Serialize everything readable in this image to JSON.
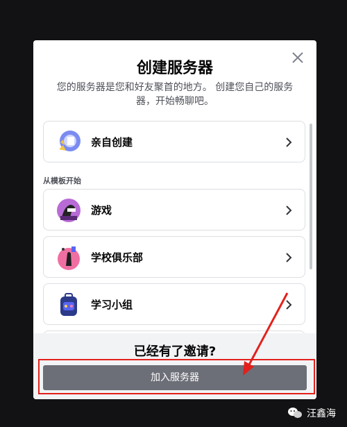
{
  "modal": {
    "title": "创建服务器",
    "subtitle": "您的服务器是您和好友聚首的地方。 创建您自己的服务器，开始畅聊吧。",
    "close_icon": "close-icon"
  },
  "options": {
    "create_own": {
      "label": "亲自创建",
      "icon": "create-own-icon"
    },
    "section_label": "从模板开始",
    "templates": [
      {
        "label": "游戏",
        "icon": "gaming-icon"
      },
      {
        "label": "学校俱乐部",
        "icon": "school-club-icon"
      },
      {
        "label": "学习小组",
        "icon": "study-group-icon"
      }
    ]
  },
  "footer": {
    "title": "已经有了邀请?",
    "join_button": "加入服务器"
  },
  "annotation": {
    "highlight_color": "#e3201b"
  },
  "watermark": {
    "text": "汪鑫海",
    "icon": "wechat-icon"
  },
  "colors": {
    "button_gray": "#6d6f78",
    "footer_bg": "#f2f3f5"
  }
}
